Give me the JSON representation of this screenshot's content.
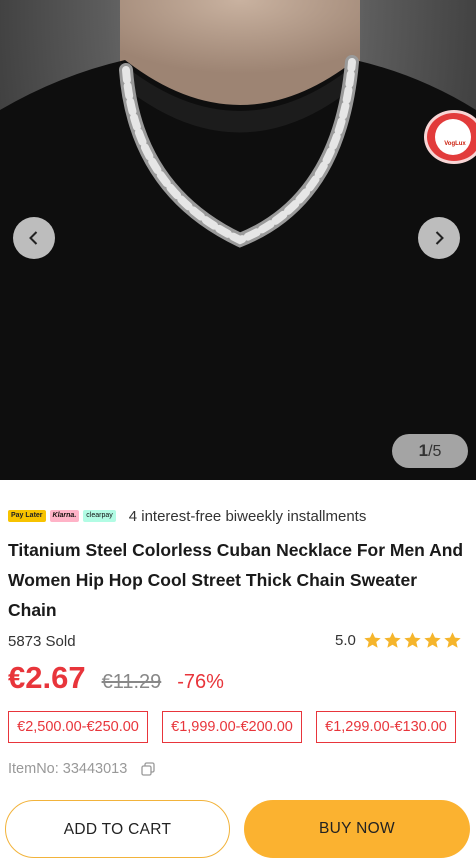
{
  "gallery": {
    "current": "1",
    "total": "/5",
    "prev_icon": "chevron-left-icon",
    "next_icon": "chevron-right-icon",
    "badge_icon": "vogue-badge-icon",
    "badge_text": "VogLux"
  },
  "payment": {
    "logos": [
      "Pay Later",
      "Klarna.",
      "clearpay"
    ],
    "text": "4 interest-free biweekly installments"
  },
  "product": {
    "title": "Titanium Steel Colorless Cuban Necklace For Men And Women Hip Hop Cool Street Thick Chain Sweater Chain",
    "sold": "5873 Sold",
    "rating": "5.0",
    "stars": 5,
    "price": "€2.67",
    "original_price": "€11.29",
    "discount": "-76%",
    "item_no": "ItemNo: 33443013"
  },
  "coupons": [
    "€2,500.00-€250.00",
    "€1,999.00-€200.00",
    "€1,299.00-€130.00"
  ],
  "actions": {
    "add_to_cart": "ADD TO CART",
    "buy_now": "BUY NOW"
  },
  "colors": {
    "price_red": "#e8353b",
    "buy_orange": "#fbb230",
    "star_gold": "#f5b52c"
  }
}
